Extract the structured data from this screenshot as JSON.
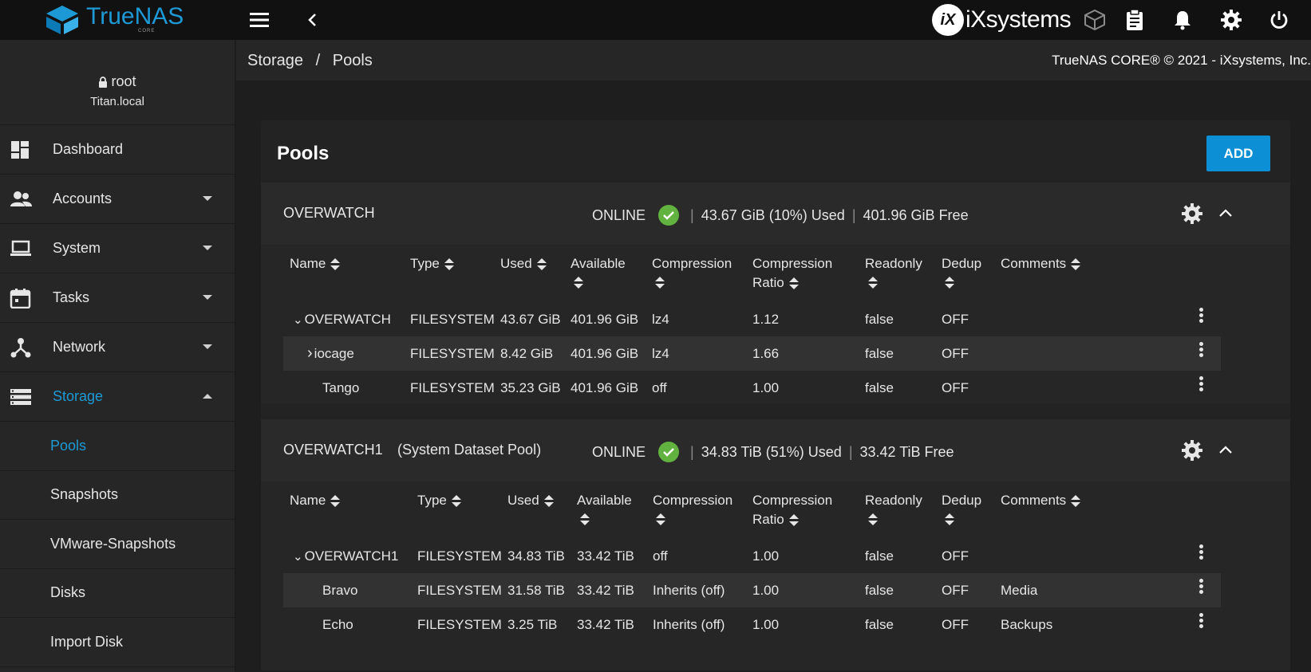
{
  "app": {
    "logo_text": "TrueNAS",
    "logo_sub": "CORE",
    "vendor_logo": "iXsystems"
  },
  "user": {
    "name": "root",
    "host": "Titan.local"
  },
  "nav": [
    {
      "label": "Dashboard",
      "icon": "dashboard-icon",
      "has_caret": false
    },
    {
      "label": "Accounts",
      "icon": "accounts-icon",
      "has_caret": true
    },
    {
      "label": "System",
      "icon": "system-icon",
      "has_caret": true
    },
    {
      "label": "Tasks",
      "icon": "tasks-icon",
      "has_caret": true
    },
    {
      "label": "Network",
      "icon": "network-icon",
      "has_caret": true
    },
    {
      "label": "Storage",
      "icon": "storage-icon",
      "has_caret": true,
      "expanded": true
    }
  ],
  "storage_sub": [
    "Pools",
    "Snapshots",
    "VMware-Snapshots",
    "Disks",
    "Import Disk"
  ],
  "breadcrumb": {
    "parent": "Storage",
    "separator": "/",
    "current": "Pools"
  },
  "copyright": "TrueNAS CORE® © 2021 - iXsystems, Inc.",
  "page": {
    "title": "Pools",
    "add_label": "ADD"
  },
  "columns": [
    "Name",
    "Type",
    "Used",
    "Available",
    "Compression",
    "Compression",
    "Ratio",
    "Readonly",
    "Dedup",
    "Comments"
  ],
  "pools": [
    {
      "name": "OVERWATCH",
      "subtitle": "",
      "status": "ONLINE",
      "used": "43.67 GiB (10%) Used",
      "free": "401.96 GiB Free",
      "rows": [
        {
          "name": "OVERWATCH",
          "expander": "⌄",
          "type": "FILESYSTEM",
          "used": "43.67 GiB",
          "available": "401.96 GiB",
          "compression": "lz4",
          "ratio": "1.12",
          "readonly": "false",
          "dedup": "OFF",
          "comments": ""
        },
        {
          "name": "iocage",
          "expander": "›",
          "type": "FILESYSTEM",
          "used": "8.42 GiB",
          "available": "401.96 GiB",
          "compression": "lz4",
          "ratio": "1.66",
          "readonly": "false",
          "dedup": "OFF",
          "comments": ""
        },
        {
          "name": "Tango",
          "expander": "",
          "type": "FILESYSTEM",
          "used": "35.23 GiB",
          "available": "401.96 GiB",
          "compression": "off",
          "ratio": "1.00",
          "readonly": "false",
          "dedup": "OFF",
          "comments": ""
        }
      ]
    },
    {
      "name": "OVERWATCH1",
      "subtitle": "(System Dataset Pool)",
      "status": "ONLINE",
      "used": "34.83 TiB (51%) Used",
      "free": "33.42 TiB Free",
      "rows": [
        {
          "name": "OVERWATCH1",
          "expander": "⌄",
          "type": "FILESYSTEM",
          "used": "34.83 TiB",
          "available": "33.42 TiB",
          "compression": "off",
          "ratio": "1.00",
          "readonly": "false",
          "dedup": "OFF",
          "comments": ""
        },
        {
          "name": "Bravo",
          "expander": "",
          "type": "FILESYSTEM",
          "used": "31.58 TiB",
          "available": "33.42 TiB",
          "compression": "Inherits (off)",
          "ratio": "1.00",
          "readonly": "false",
          "dedup": "OFF",
          "comments": "Media"
        },
        {
          "name": "Echo",
          "expander": "",
          "type": "FILESYSTEM",
          "used": "3.25 TiB",
          "available": "33.42 TiB",
          "compression": "Inherits (off)",
          "ratio": "1.00",
          "readonly": "false",
          "dedup": "OFF",
          "comments": "Backups"
        }
      ]
    }
  ],
  "colors": {
    "accent": "#1d9ad6",
    "button": "#0d8fd6",
    "online": "#62b23f",
    "topbar": "#111111"
  }
}
